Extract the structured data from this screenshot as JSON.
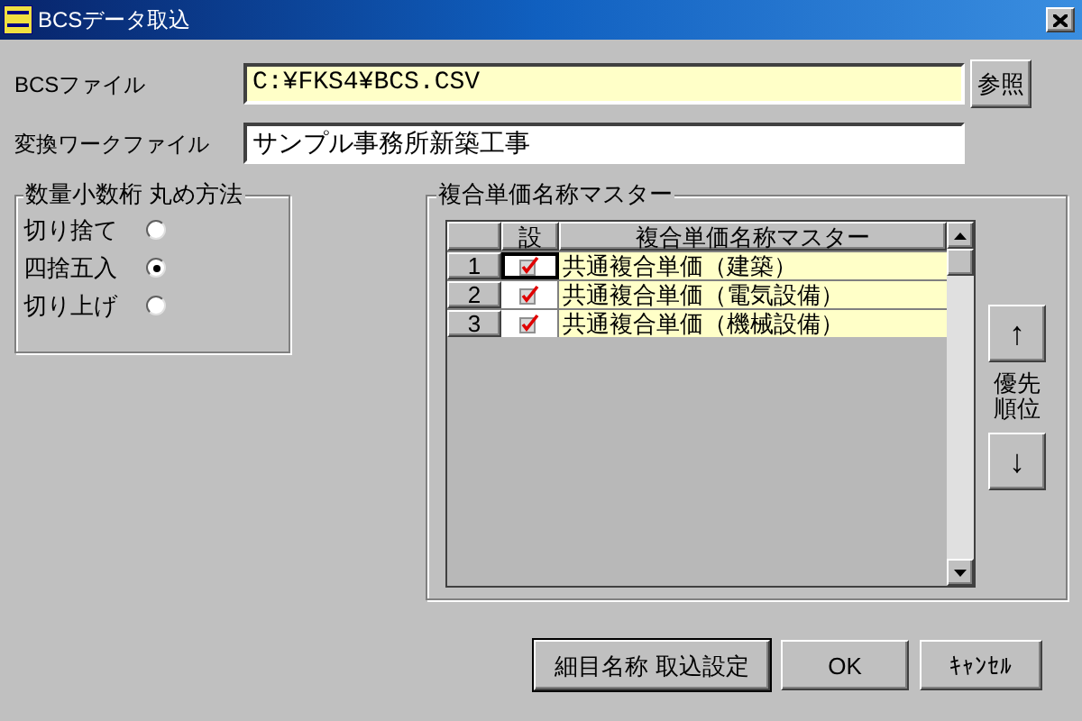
{
  "window": {
    "title": "BCSデータ取込"
  },
  "fields": [
    {
      "label": "BCSファイル",
      "value": "C:¥FKS4¥BCS.CSV",
      "highlighted": true
    },
    {
      "label": "変換ワークファイル",
      "value": "サンプル事務所新築工事",
      "highlighted": false
    }
  ],
  "browse_button": "参照",
  "rounding": {
    "title": "数量小数桁 丸め方法",
    "options": [
      {
        "label": "切り捨て",
        "selected": false
      },
      {
        "label": "四捨五入",
        "selected": true
      },
      {
        "label": "切り上げ",
        "selected": false
      }
    ]
  },
  "master": {
    "title": "複合単価名称マスター",
    "columns": [
      "設",
      "複合単価名称マスター"
    ],
    "rows": [
      {
        "number": "1",
        "checked": true,
        "name": "共通複合単価（建築）"
      },
      {
        "number": "2",
        "checked": true,
        "name": "共通複合単価（電気設備）"
      },
      {
        "number": "3",
        "checked": true,
        "name": "共通複合単価（機械設備）"
      }
    ]
  },
  "priority": {
    "up": "↑",
    "label": "優先順位",
    "down": "↓"
  },
  "buttons": [
    {
      "label": "細目名称 取込設定",
      "focused": true
    },
    {
      "label": "OK",
      "focused": false
    },
    {
      "label": "ｷｬﾝｾﾙ",
      "focused": false
    }
  ]
}
